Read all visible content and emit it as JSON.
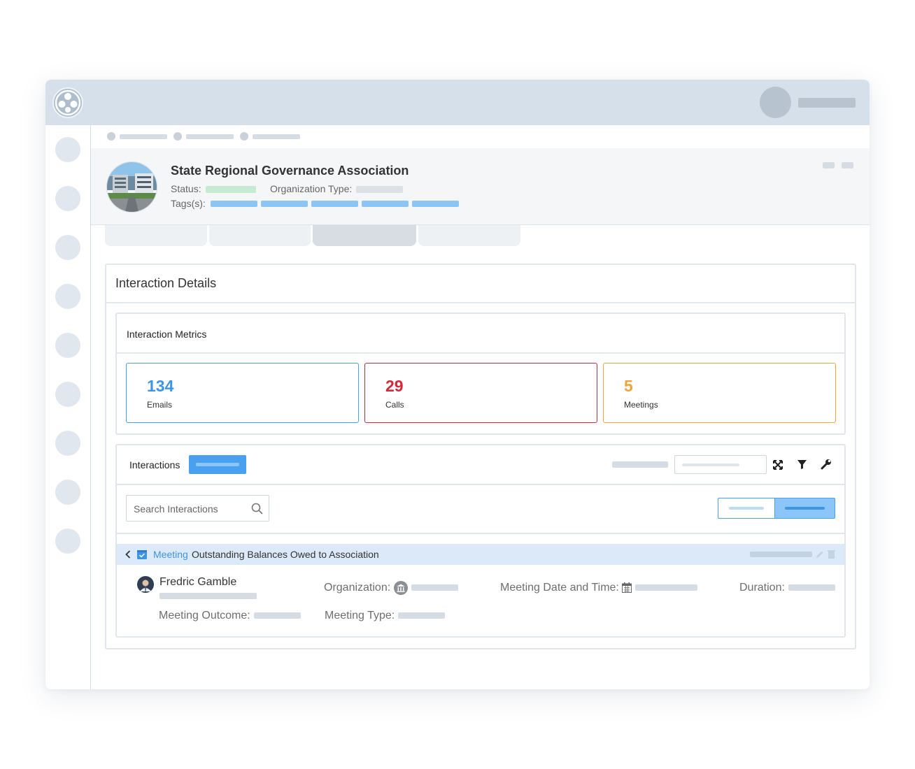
{
  "organization": {
    "name": "State Regional Governance Association",
    "status_label": "Status:",
    "org_type_label": "Organization Type:",
    "tags_label": "Tags(s):"
  },
  "panel": {
    "title": "Interaction Details"
  },
  "metrics": {
    "title": "Interaction Metrics",
    "cards": [
      {
        "value": "134",
        "label": "Emails",
        "color": "#3e95e6"
      },
      {
        "value": "29",
        "label": "Calls",
        "color": "#d3283b"
      },
      {
        "value": "5",
        "label": "Meetings",
        "color": "#f2a33a"
      }
    ]
  },
  "interactions": {
    "title": "Interactions",
    "search_placeholder": "Search Interactions",
    "item": {
      "type": "Meeting",
      "title": "Outstanding Balances Owed to Association",
      "contact_name": "Fredric Gamble",
      "organization_label": "Organization:",
      "meeting_date_label": "Meeting Date and Time:",
      "duration_label": "Duration:",
      "outcome_label": "Meeting Outcome:",
      "meeting_type_label": "Meeting Type:"
    }
  },
  "icons": {
    "logo": "app-logo-icon",
    "search": "search-icon",
    "collapse": "collapse-icon",
    "filter": "filter-icon",
    "settings": "wrench-icon",
    "calendar": "calendar-icon",
    "organization": "bank-icon",
    "edit": "pencil-icon",
    "delete": "trash-icon",
    "chevron": "chevron-left-icon"
  },
  "colors": {
    "accent": "#4aa0f0",
    "status": "#c6ebd3",
    "tag": "#8cc5f4"
  }
}
